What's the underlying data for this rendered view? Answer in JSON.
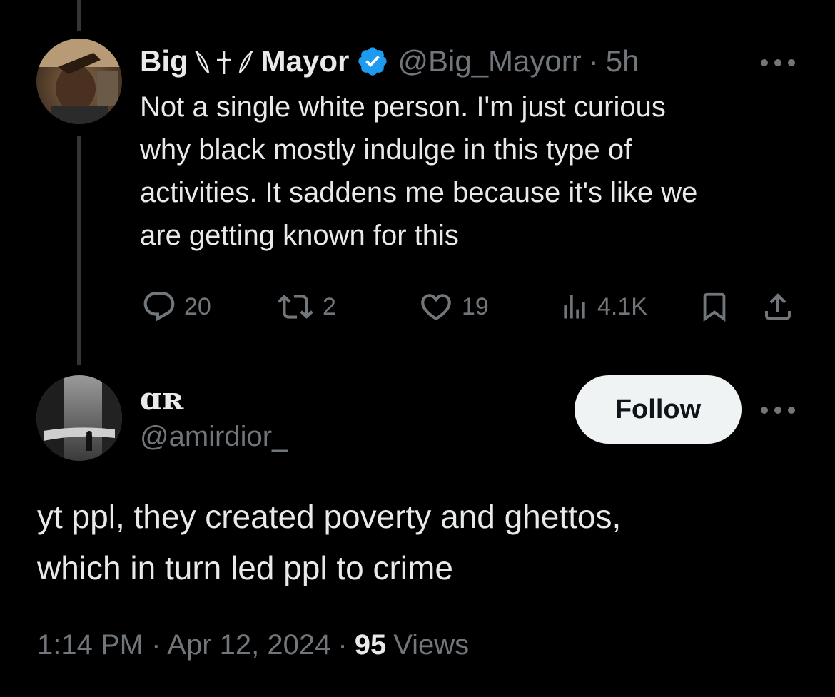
{
  "parent_tweet": {
    "display_name_first": "Big",
    "display_name_last": "Mayor",
    "name_decoration_icon": "wings-cross-emoji",
    "verified_icon": "verified-badge-icon",
    "handle": "@Big_Mayorr",
    "separator": "·",
    "time_ago": "5h",
    "text": "Not a single white person. I'm just curious\nwhy black mostly indulge in this type of\nactivities. It saddens me because it's like we\nare getting known for this",
    "actions": {
      "replies": "20",
      "reposts": "2",
      "likes": "19",
      "views": "4.1K"
    }
  },
  "reply_tweet": {
    "display_name": "ɑʀ",
    "handle": "@amirdior_",
    "follow_label": "Follow",
    "text": "yt ppl, they created poverty and ghettos,\nwhich in turn led ppl to crime",
    "timestamp": "1:14 PM · Apr 12, 2024",
    "separator": "·",
    "views_count": "95",
    "views_label": "Views"
  },
  "colors": {
    "background": "#000000",
    "text_primary": "#e7e9ea",
    "text_secondary": "#71767b",
    "verified": "#1d9bf0",
    "follow_bg": "#eff3f4",
    "thread_line": "#333639"
  }
}
